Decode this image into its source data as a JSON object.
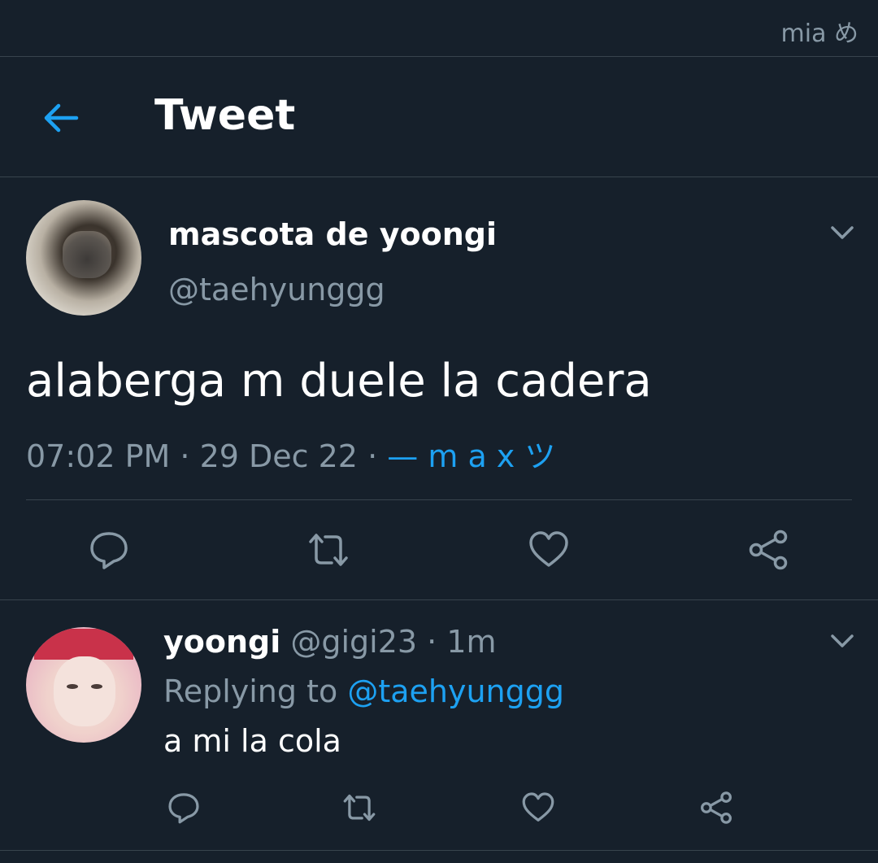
{
  "status_bar": {
    "text": "mia め"
  },
  "header": {
    "title": "Tweet",
    "back_icon": "arrow-left-icon"
  },
  "tweet": {
    "author_name": "mascota de yoongi",
    "author_handle": "@taehyunggg",
    "text": "alaberga m duele la cadera",
    "time": "07:02 PM",
    "date": "29 Dec 22",
    "separator": "·",
    "source": "— m a x ツ",
    "actions": [
      "reply-icon",
      "retweet-icon",
      "like-icon",
      "share-icon"
    ]
  },
  "reply": {
    "author_name": "yoongi",
    "author_handle": "@gigi23",
    "separator": "·",
    "time_ago": "1m",
    "replying_prefix": "Replying to",
    "replying_to": "@taehyunggg",
    "text": "a mi la cola",
    "actions": [
      "reply-icon",
      "retweet-icon",
      "like-icon",
      "share-icon"
    ]
  },
  "colors": {
    "background": "#16202b",
    "divider": "#38444d",
    "accent": "#1da1f2",
    "secondary_text": "#8899a6",
    "primary_text": "#ffffff"
  }
}
